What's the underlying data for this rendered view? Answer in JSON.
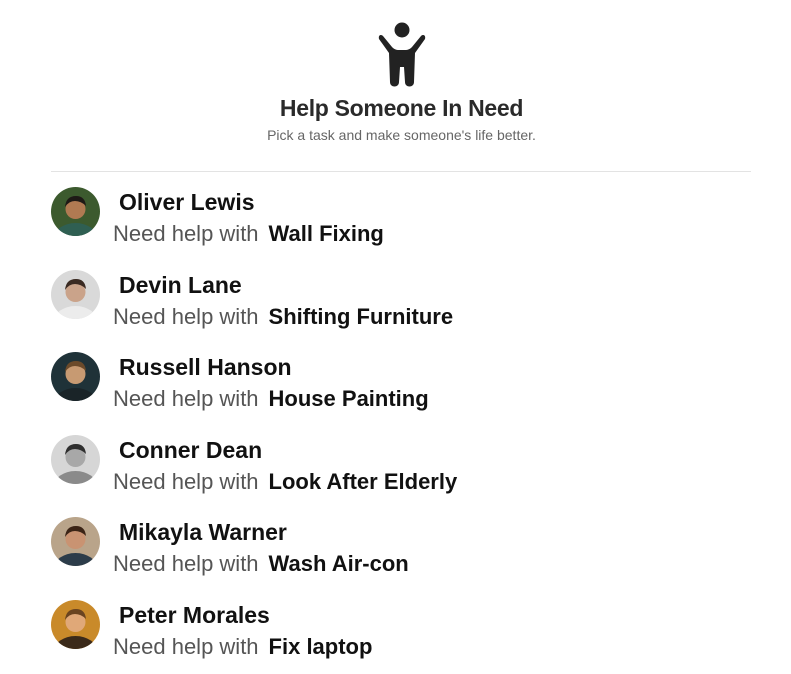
{
  "header": {
    "icon": "person-arms-raised-icon",
    "title": "Help Someone In Need",
    "subtitle": "Pick a task and make someone's life better."
  },
  "requests": [
    {
      "name": "Oliver Lewis",
      "need_label": "Need help with",
      "task": "Wall Fixing",
      "avatar": "avatar-photo",
      "avatar_bg": "#3c5a2e",
      "avatar_skin": "#b07a52",
      "avatar_hair": "#1e1a16",
      "avatar_shirt": "#2f5f52"
    },
    {
      "name": "Devin Lane",
      "need_label": "Need help with",
      "task": "Shifting Furniture",
      "avatar": "avatar-photo",
      "avatar_bg": "#d9d9d9",
      "avatar_skin": "#caa38a",
      "avatar_hair": "#3a2a22",
      "avatar_shirt": "#ececec"
    },
    {
      "name": "Russell Hanson",
      "need_label": "Need help with",
      "task": "House Painting",
      "avatar": "avatar-photo",
      "avatar_bg": "#1f3238",
      "avatar_skin": "#c79a72",
      "avatar_hair": "#6b4a2a",
      "avatar_shirt": "#1a2428"
    },
    {
      "name": "Conner Dean",
      "need_label": "Need help with",
      "task": "Look After Elderly",
      "avatar": "avatar-photo",
      "avatar_bg": "#d6d6d6",
      "avatar_skin": "#a8a8a8",
      "avatar_hair": "#2e2e2e",
      "avatar_shirt": "#8a8a8a"
    },
    {
      "name": "Mikayla Warner",
      "need_label": "Need help with",
      "task": "Wash Air-con",
      "avatar": "avatar-photo",
      "avatar_bg": "#b9a48a",
      "avatar_skin": "#c99372",
      "avatar_hair": "#3b2416",
      "avatar_shirt": "#2c3c4a"
    },
    {
      "name": "Peter Morales",
      "need_label": "Need help with",
      "task": "Fix laptop",
      "avatar": "avatar-photo",
      "avatar_bg": "#c98a2a",
      "avatar_skin": "#e0a878",
      "avatar_hair": "#6a4420",
      "avatar_shirt": "#3b2a1a"
    }
  ]
}
